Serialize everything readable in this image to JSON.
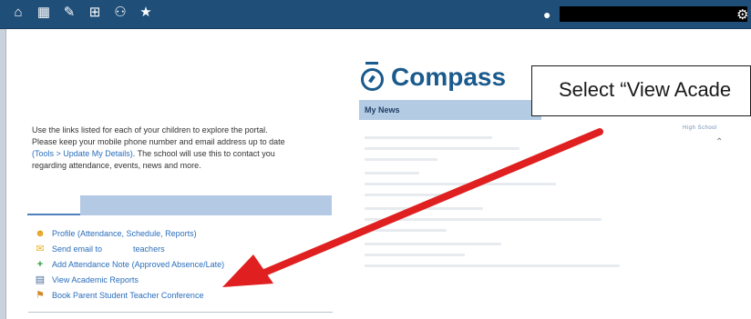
{
  "topbar": {
    "icons": [
      "home-icon",
      "calendar-icon",
      "pencil-icon",
      "grid-icon",
      "people-icon",
      "star-icon"
    ],
    "glyphs": [
      "⌂",
      "▦",
      "✎",
      "▦",
      "👥",
      "★"
    ],
    "user_icon": "user-icon",
    "settings_icon": "gear-icon",
    "colors": {
      "bar": "#1f4e79"
    }
  },
  "intro": {
    "line1": "Use the links listed for each of your children to explore the portal.",
    "line2": "Please keep your mobile phone number and email address up to date",
    "link_text": "(Tools > Update My Details)",
    "line3_rest": ". The school will use this to contact you",
    "line4": "regarding attendance, events, news and more."
  },
  "links": {
    "profile": "Profile (Attendance, Schedule, Reports)",
    "send_email_prefix": "Send email to",
    "send_email_suffix": "teachers",
    "attendance_note": "Add Attendance Note (Approved Absence/Late)",
    "academic_reports": "View Academic Reports",
    "book_conference": "Book Parent Student Teacher Conference"
  },
  "brand": {
    "name": "Compass",
    "color": "#1a5a8c"
  },
  "news": {
    "title": "My News",
    "school_label": "High School"
  },
  "callout": {
    "text": "Select “View Acade"
  },
  "annotation": {
    "arrow_color": "#e02020"
  }
}
